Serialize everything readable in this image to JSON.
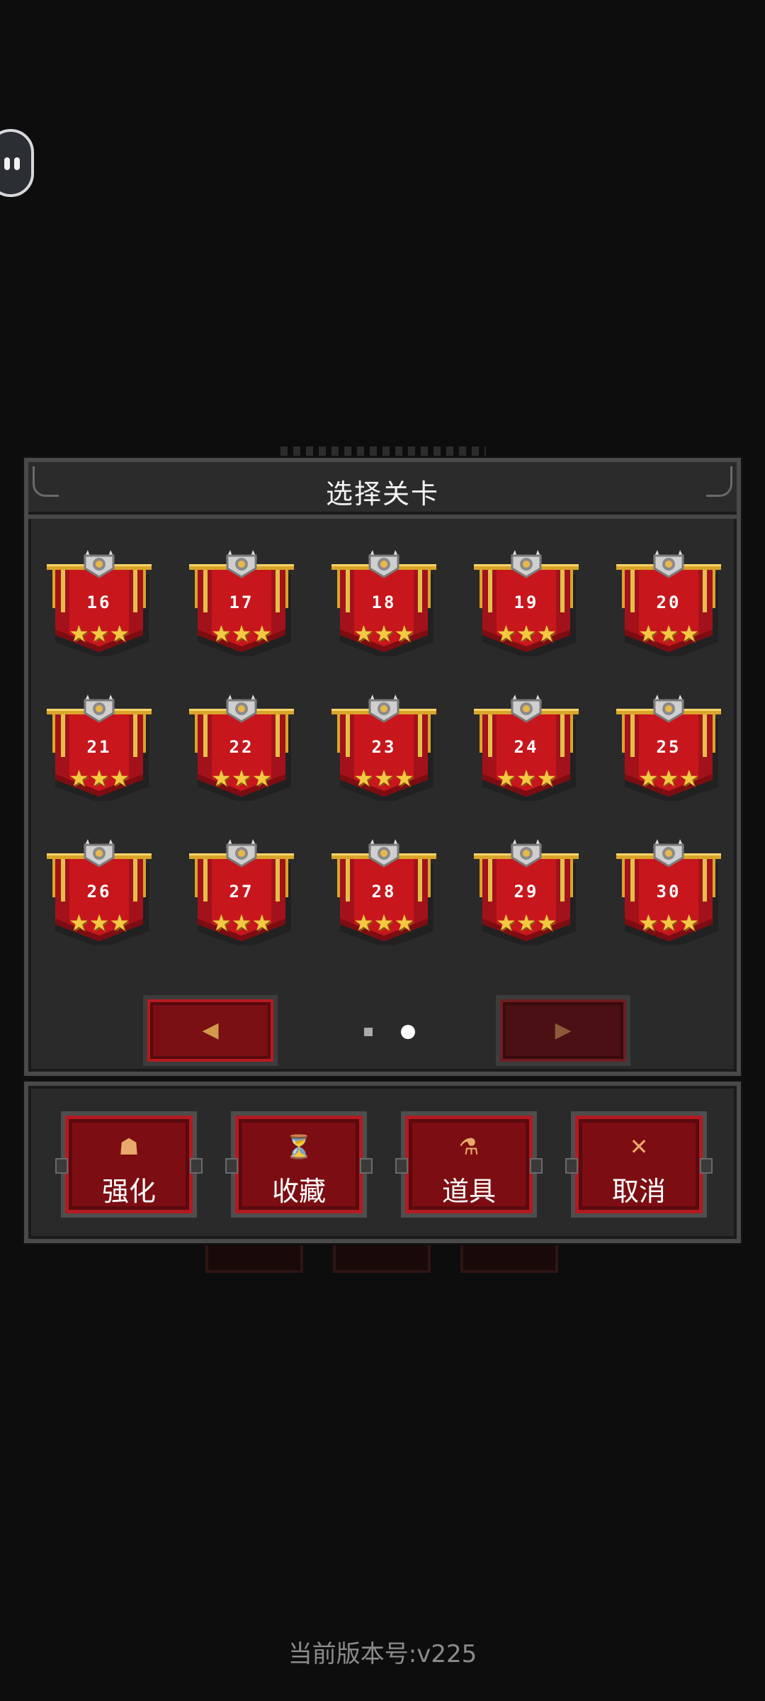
{
  "dialog": {
    "title": "选择关卡"
  },
  "levels": [
    {
      "number": "16",
      "stars": "★★★"
    },
    {
      "number": "17",
      "stars": "★★★"
    },
    {
      "number": "18",
      "stars": "★★★"
    },
    {
      "number": "19",
      "stars": "★★★"
    },
    {
      "number": "20",
      "stars": "★★★"
    },
    {
      "number": "21",
      "stars": "★★★"
    },
    {
      "number": "22",
      "stars": "★★★"
    },
    {
      "number": "23",
      "stars": "★★★"
    },
    {
      "number": "24",
      "stars": "★★★"
    },
    {
      "number": "25",
      "stars": "★★★"
    },
    {
      "number": "26",
      "stars": "★★★"
    },
    {
      "number": "27",
      "stars": "★★★"
    },
    {
      "number": "28",
      "stars": "★★★"
    },
    {
      "number": "29",
      "stars": "★★★"
    },
    {
      "number": "30",
      "stars": "★★★"
    }
  ],
  "pager": {
    "prev_icon": "◀",
    "next_icon": "▶",
    "pages": 2,
    "current_page": 2
  },
  "actions": [
    {
      "icon": "☗",
      "icon_name": "upgrade-icon",
      "label": "强化"
    },
    {
      "icon": "⏳",
      "icon_name": "trophy-cup-icon",
      "label": "收藏"
    },
    {
      "icon": "⚗",
      "icon_name": "potion-flask-icon",
      "label": "道具"
    },
    {
      "icon": "✕",
      "icon_name": "close-icon",
      "label": "取消"
    }
  ],
  "footer": {
    "version_text": "当前版本号:v225"
  },
  "colors": {
    "banner_red": "#c8161d",
    "banner_dark": "#8a0e13",
    "star_gold": "#f5c842",
    "button_red": "#7c0e13",
    "panel_bg": "#2a2a2a"
  }
}
